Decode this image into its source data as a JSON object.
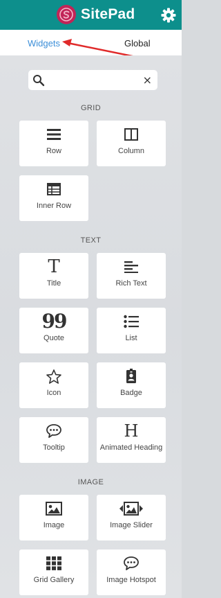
{
  "app": {
    "title": "SitePad"
  },
  "tabs": [
    {
      "label": "Widgets"
    },
    {
      "label": "Global"
    }
  ],
  "search": {
    "placeholder": "",
    "clear": "×"
  },
  "sections": {
    "grid": "GRID",
    "text": "TEXT",
    "image": "IMAGE"
  },
  "widgets": {
    "row": "Row",
    "column": "Column",
    "inner_row": "Inner Row",
    "title": "Title",
    "rich_text": "Rich Text",
    "quote": "Quote",
    "list": "List",
    "icon": "Icon",
    "badge": "Badge",
    "tooltip": "Tooltip",
    "animated_heading": "Animated Heading",
    "image": "Image",
    "image_slider": "Image Slider",
    "grid_gallery": "Grid Gallery",
    "image_hotspot": "Image Hotspot"
  },
  "icons": {
    "title_glyph": "T",
    "animated_heading_glyph": "H",
    "quote_glyph": "99"
  },
  "colors": {
    "topbar": "#0d8f8c",
    "logo": "#c12457",
    "active_tab": "#3b8ed8",
    "arrow": "#e02a2a"
  }
}
